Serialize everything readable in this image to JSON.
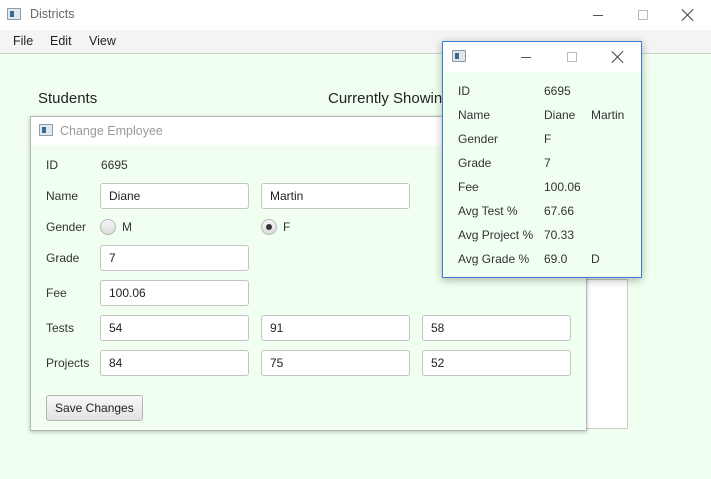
{
  "window": {
    "title": "Districts"
  },
  "menu": {
    "file": "File",
    "edit": "Edit",
    "view": "View"
  },
  "main": {
    "students_heading": "Students",
    "currently_showing": "Currently Showing"
  },
  "dialog": {
    "title": "Change Employee",
    "labels": {
      "id": "ID",
      "name": "Name",
      "gender": "Gender",
      "grade": "Grade",
      "fee": "Fee",
      "tests": "Tests",
      "projects": "Projects"
    },
    "id_value": "6695",
    "first_name": "Diane",
    "last_name": "Martin",
    "gender_m": "M",
    "gender_f": "F",
    "gender_selected": "F",
    "grade": "7",
    "fee": "100.06",
    "tests": [
      "54",
      "91",
      "58"
    ],
    "projects": [
      "84",
      "75",
      "52"
    ],
    "save_label": "Save Changes"
  },
  "details": {
    "labels": {
      "id": "ID",
      "name": "Name",
      "gender": "Gender",
      "grade": "Grade",
      "fee": "Fee",
      "avg_test": "Avg Test %",
      "avg_project": "Avg Project %",
      "avg_grade": "Avg Grade %"
    },
    "id": "6695",
    "first_name": "Diane",
    "last_name": "Martin",
    "gender": "F",
    "grade": "7",
    "fee": "100.06",
    "avg_test": "67.66",
    "avg_project": "70.33",
    "avg_grade": "69.0",
    "letter_grade": "D"
  },
  "colors": {
    "background": "#f0fff0",
    "popup_border": "#3c7fd0"
  }
}
